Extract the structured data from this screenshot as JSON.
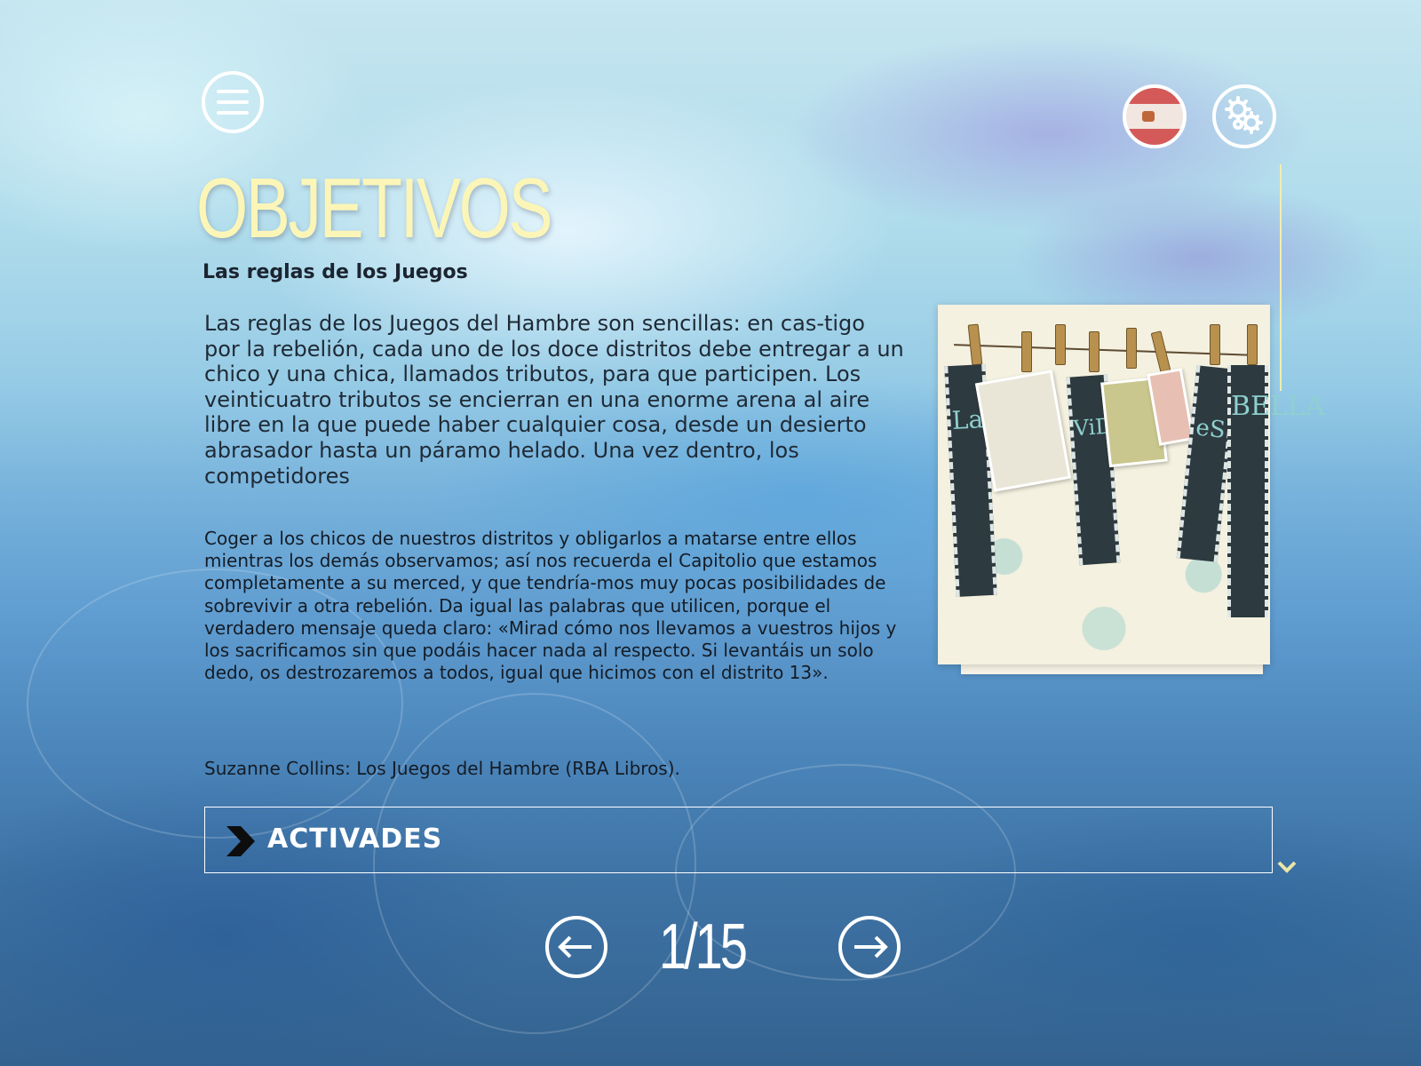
{
  "header": {
    "title": "OBJETIVOS",
    "subtitle": "Las reglas de los Juegos"
  },
  "toolbar": {
    "menu_icon": "hamburger-icon",
    "language_icon": "spain-flag-icon",
    "settings_icon": "gears-icon"
  },
  "content": {
    "paragraph_1": "Las reglas de los Juegos del Hambre son sencillas: en cas-tigo por la rebelión, cada uno de los doce distritos debe entregar a un chico y una chica, llamados tributos, para que participen. Los veinticuatro tributos se encierran en una enorme arena al aire libre en la que puede haber cualquier cosa, desde un desierto abrasador hasta un páramo helado. Una vez dentro, los competidores",
    "paragraph_2": "Coger a los chicos de nuestros distritos y obligarlos a matarse entre ellos mientras los demás observamos; así nos recuerda el Capitolio que estamos completamente a su merced, y que tendría-mos muy pocas posibilidades de sobrevivir a otra rebelión. Da igual las palabras que utilicen, porque el verdadero mensaje queda claro: «Mirad cómo nos llevamos a vuestros hijos y los sacrificamos sin que podáis hacer nada al respecto. Si levantáis un solo dedo, os destrozaremos a todos, igual que hicimos con el distrito 13».",
    "citation": "Suzanne Collins: Los Juegos del Hambre (RBA Libros)."
  },
  "illustration": {
    "film_left": "La",
    "film_middle": "ViDA",
    "film_right_1": "eS",
    "film_right_2": "BELLA"
  },
  "activities": {
    "label": "ACTIVADES"
  },
  "pagination": {
    "current": "1",
    "total": "15",
    "display": "1/15"
  },
  "colors": {
    "title": "#fbf6b8",
    "accent_line": "#f1eeb0",
    "chevron": "#e9e6a6"
  }
}
